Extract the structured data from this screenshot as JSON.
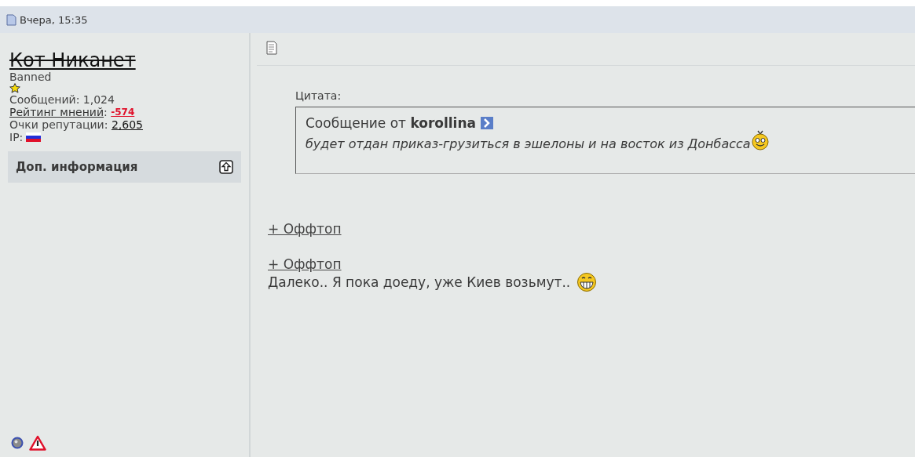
{
  "post_header": {
    "date": "Вчера, 15:35"
  },
  "user": {
    "name": "Кот Никанет",
    "banned": true,
    "title": "Banned",
    "posts": "Сообщений: 1,024",
    "rating_label": "Рейтинг мнений",
    "rating_sep": ":",
    "rating_value": "-574",
    "reputation_label": "Очки репутации:",
    "reputation_value": "2,605",
    "ip_label": "IP:",
    "more_info": "Доп. информация"
  },
  "quote": {
    "label": "Цитата:",
    "author_line": "Сообщение от **korollina**",
    "text": "будет отдан приказ-грузиться в эшелоны и на восток из Донбасса"
  },
  "spoilers": [
    "+ Оффтоп",
    "+ Оффтоп"
  ],
  "message": "Далеко.. Я пока доеду, уже Киев возьмут.."
}
